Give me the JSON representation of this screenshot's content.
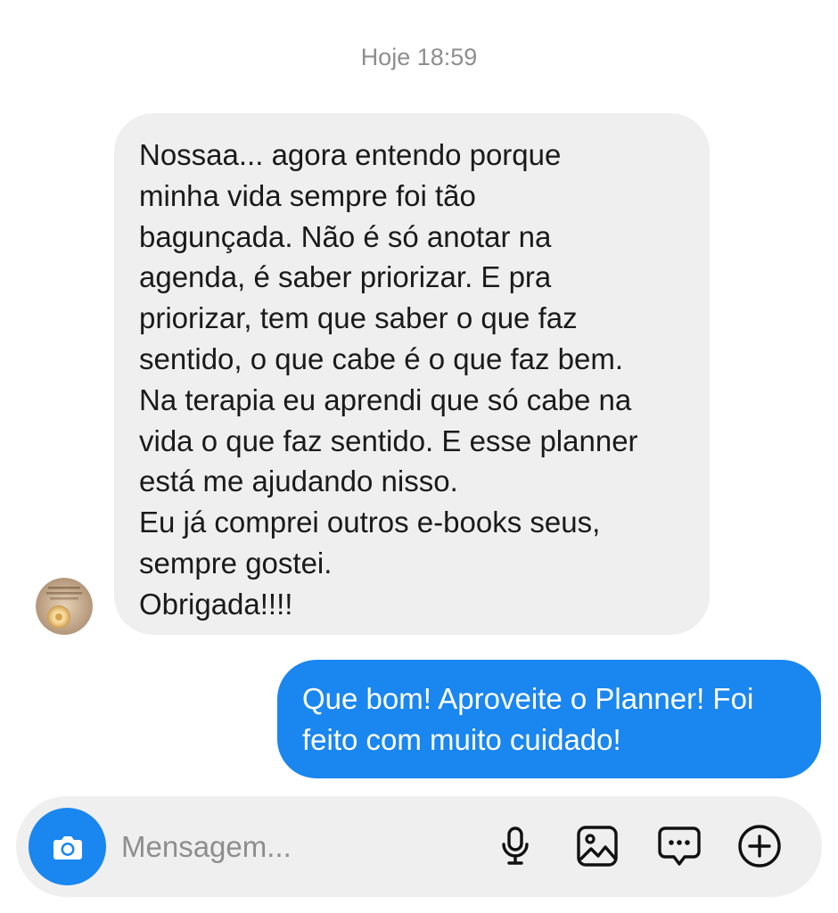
{
  "thread": {
    "timestamp": "Hoje 18:59"
  },
  "incoming_message": {
    "lines": [
      "Nossaa... agora entendo porque",
      "minha vida sempre foi tão",
      "bagunçada. Não é só anotar na",
      "agenda, é saber priorizar. E pra",
      "priorizar, tem que saber o que faz",
      "sentido, o que cabe é o que faz bem.",
      "Na terapia eu aprendi que só cabe na",
      "vida o que faz sentido. E esse planner",
      "está me ajudando nisso.",
      "Eu já comprei outros e-books seus,",
      "sempre gostei.",
      "Obrigada!!!!"
    ],
    "avatar": "sender-avatar"
  },
  "outgoing_message": {
    "lines": [
      "Que bom! Aproveite o Planner! Foi",
      "feito com muito cuidado!"
    ]
  },
  "composer": {
    "placeholder": "Mensagem...",
    "value": "",
    "icons": {
      "camera": "camera-icon",
      "microphone": "microphone-icon",
      "gallery": "image-icon",
      "sticker": "chat-bubble-icon",
      "more": "plus-circle-icon"
    }
  },
  "colors": {
    "accent": "#1a86f0",
    "incoming_bubble": "#efefef",
    "timestamp": "#8e8e8e"
  }
}
